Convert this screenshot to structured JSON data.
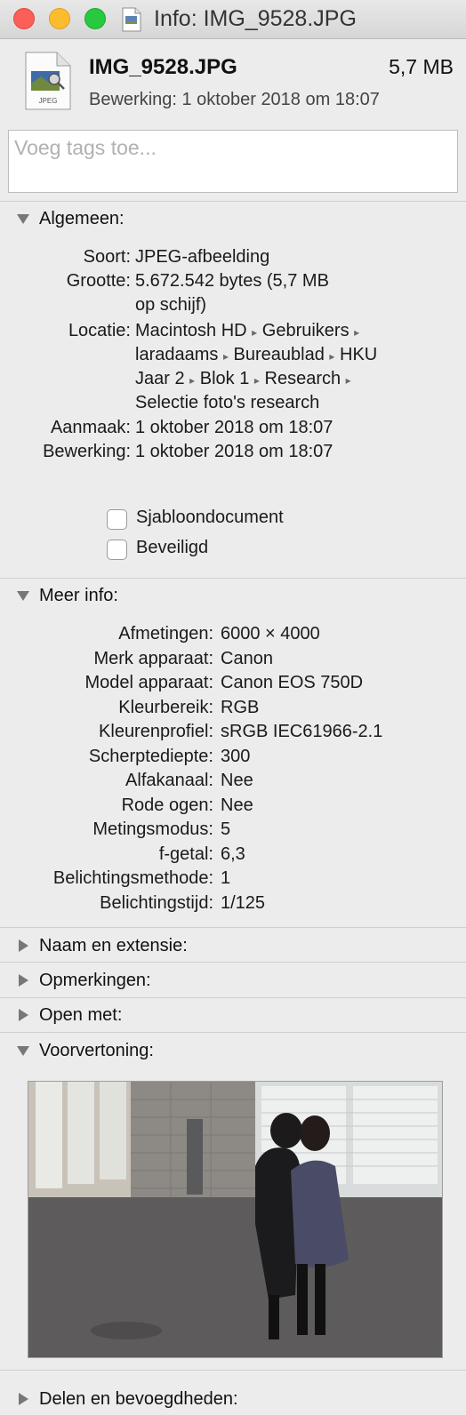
{
  "window": {
    "title": "Info: IMG_9528.JPG"
  },
  "file": {
    "name": "IMG_9528.JPG",
    "size": "5,7 MB",
    "modified_line": "Bewerking: 1 oktober 2018 om 18:07",
    "icon_label": "JPEG"
  },
  "tags": {
    "placeholder": "Voeg tags toe..."
  },
  "general": {
    "title": "Algemeen:",
    "kind_label": "Soort:",
    "kind": "JPEG-afbeelding",
    "size_label": "Grootte:",
    "size_line1": "5.672.542 bytes (5,7 MB",
    "size_line2": "op schijf)",
    "where_label": "Locatie:",
    "path": [
      "Macintosh HD",
      "Gebruikers",
      "laradaams",
      "Bureaublad",
      "HKU",
      "Jaar 2",
      "Blok 1",
      "Research",
      "Selectie foto's research"
    ],
    "created_label": "Aanmaak:",
    "created": "1 oktober 2018 om 18:07",
    "modified_label": "Bewerking:",
    "modified": "1 oktober 2018 om 18:07",
    "stationery_label": "Sjabloondocument",
    "stationery_checked": false,
    "locked_label": "Beveiligd",
    "locked_checked": false
  },
  "more_info": {
    "title": "Meer info:",
    "rows": [
      {
        "label": "Afmetingen:",
        "value": "6000 × 4000"
      },
      {
        "label": "Merk apparaat:",
        "value": "Canon"
      },
      {
        "label": "Model apparaat:",
        "value": "Canon EOS 750D"
      },
      {
        "label": "Kleurbereik:",
        "value": "RGB"
      },
      {
        "label": "Kleurenprofiel:",
        "value": "sRGB IEC61966-2.1"
      },
      {
        "label": "Scherptediepte:",
        "value": "300"
      },
      {
        "label": "Alfakanaal:",
        "value": "Nee"
      },
      {
        "label": "Rode ogen:",
        "value": "Nee"
      },
      {
        "label": "Metingsmodus:",
        "value": "5"
      },
      {
        "label": "f-getal:",
        "value": "6,3"
      },
      {
        "label": "Belichtingsmethode:",
        "value": "1"
      },
      {
        "label": "Belichtingstijd:",
        "value": "1/125"
      }
    ]
  },
  "sections": {
    "name_ext": "Naam en extensie:",
    "comments": "Opmerkingen:",
    "open_with": "Open met:",
    "preview": "Voorvertoning:",
    "sharing": "Delen en bevoegdheden:"
  },
  "colors": {
    "close": "#fc5f57",
    "minimize": "#fdbc2e",
    "zoom": "#28c840",
    "window_bg": "#ececec"
  },
  "icons": {
    "disclosure_open": "triangle-down",
    "disclosure_closed": "triangle-right",
    "path_separator": "▸"
  }
}
